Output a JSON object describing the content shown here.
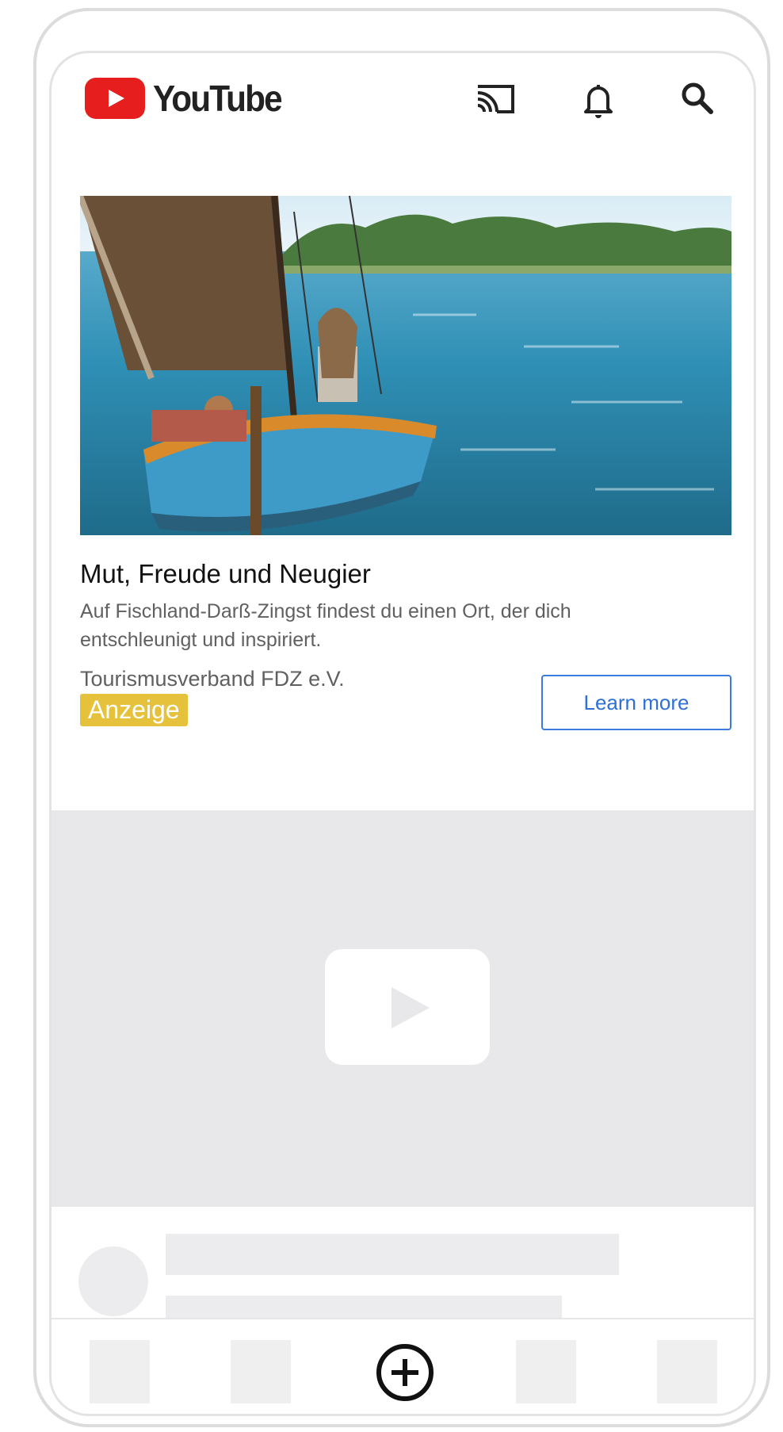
{
  "header": {
    "logo_text": "YouTube",
    "icons": [
      "cast-icon",
      "notifications-icon",
      "search-icon"
    ]
  },
  "ad": {
    "title": "Mut, Freude und Neugier",
    "description": "Auf Fischland-Darß-Zingst findest du einen Ort, der dich entschleunigt und inspiriert.",
    "advertiser": "Tourismusverband FDZ e.V.",
    "badge": "Anzeige",
    "cta_label": "Learn more"
  },
  "bottom_nav": {
    "center_icon": "create-plus-icon"
  },
  "colors": {
    "brand_red": "#e61e1e",
    "badge_yellow": "#e6c13b",
    "cta_blue": "#2f6fd6"
  }
}
